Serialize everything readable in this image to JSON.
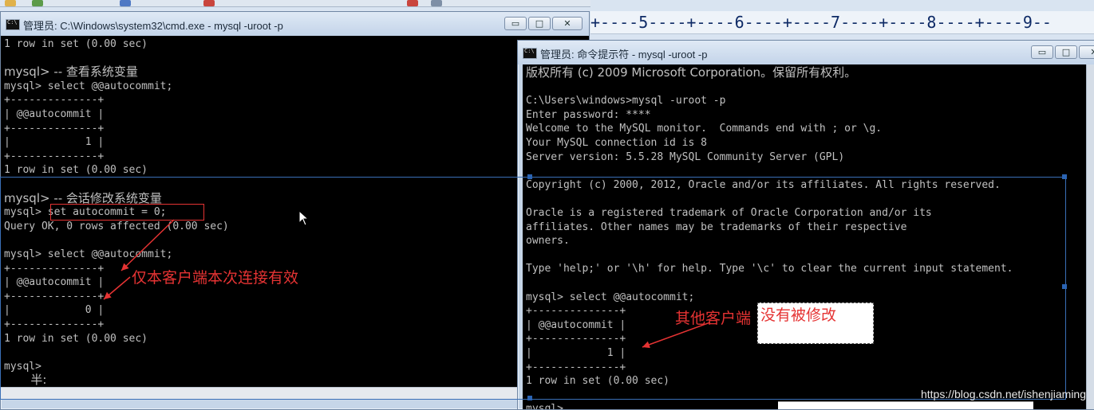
{
  "background": {
    "ruler_text": "+----5----+----6----+----7----+----8----+----9--"
  },
  "left_window": {
    "title": "管理员: C:\\Windows\\system32\\cmd.exe - mysql  -uroot -p",
    "lines": [
      "1 row in set (0.00 sec)",
      "",
      "mysql> -- 查看系统变量",
      "mysql> select @@autocommit;",
      "+--------------+",
      "| @@autocommit |",
      "+--------------+",
      "|            1 |",
      "+--------------+",
      "1 row in set (0.00 sec)",
      "",
      "mysql> -- 会话修改系统变量",
      "mysql> set autocommit = 0;",
      "Query OK, 0 rows affected (0.00 sec)",
      "",
      "mysql> select @@autocommit;",
      "+--------------+",
      "| @@autocommit |",
      "+--------------+",
      "|            0 |",
      "+--------------+",
      "1 row in set (0.00 sec)",
      "",
      "mysql>",
      "       半:"
    ],
    "annotation": "仅本客户端本次连接有效"
  },
  "right_window": {
    "title": "管理员: 命令提示符 - mysql  -uroot -p",
    "lines": [
      "版权所有 (c) 2009 Microsoft Corporation。保留所有权利。",
      "",
      "C:\\Users\\windows>mysql -uroot -p",
      "Enter password: ****",
      "Welcome to the MySQL monitor.  Commands end with ; or \\g.",
      "Your MySQL connection id is 8",
      "Server version: 5.5.28 MySQL Community Server (GPL)",
      "",
      "Copyright (c) 2000, 2012, Oracle and/or its affiliates. All rights reserved.",
      "",
      "Oracle is a registered trademark of Oracle Corporation and/or its",
      "affiliates. Other names may be trademarks of their respective",
      "owners.",
      "",
      "Type 'help;' or '\\h' for help. Type '\\c' to clear the current input statement.",
      "",
      "mysql> select @@autocommit;",
      "+--------------+",
      "| @@autocommit |",
      "+--------------+",
      "|            1 |",
      "+--------------+",
      "1 row in set (0.00 sec)",
      "",
      "mysql>"
    ],
    "annotation_a": "其他客户端",
    "annotation_b": "没有被修改"
  },
  "window_buttons": {
    "minimize": "▭",
    "maximize": "□",
    "close": "✕"
  },
  "watermark": "https://blog.csdn.net/ishenjiaming",
  "colors": {
    "console_bg": "#000000",
    "console_text": "#c0c0c0",
    "annotation": "#e53333"
  }
}
